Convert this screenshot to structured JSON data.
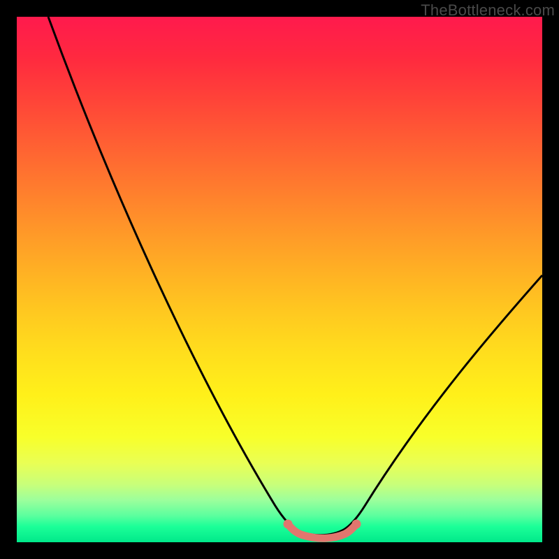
{
  "watermark": "TheBottleneck.com",
  "colors": {
    "frame": "#000000",
    "curve": "#000000",
    "segment": "#e2766e"
  },
  "chart_data": {
    "type": "line",
    "title": "",
    "xlabel": "",
    "ylabel": "",
    "xlim": [
      0,
      100
    ],
    "ylim": [
      0,
      100
    ],
    "grid": false,
    "legend": false,
    "x": [
      0,
      5,
      10,
      15,
      20,
      25,
      30,
      35,
      40,
      45,
      50,
      52,
      54,
      56,
      58,
      60,
      62,
      65,
      70,
      75,
      80,
      85,
      90,
      95,
      100
    ],
    "values": [
      100,
      92,
      83,
      74,
      65,
      56,
      47,
      38,
      29,
      20,
      11,
      7,
      4,
      3,
      3,
      3,
      4,
      7,
      14,
      22,
      30,
      38,
      46,
      53,
      60
    ],
    "annotations": [
      {
        "type": "highlight-segment",
        "x_range": [
          52,
          62
        ],
        "style": "thick-pink"
      }
    ]
  }
}
